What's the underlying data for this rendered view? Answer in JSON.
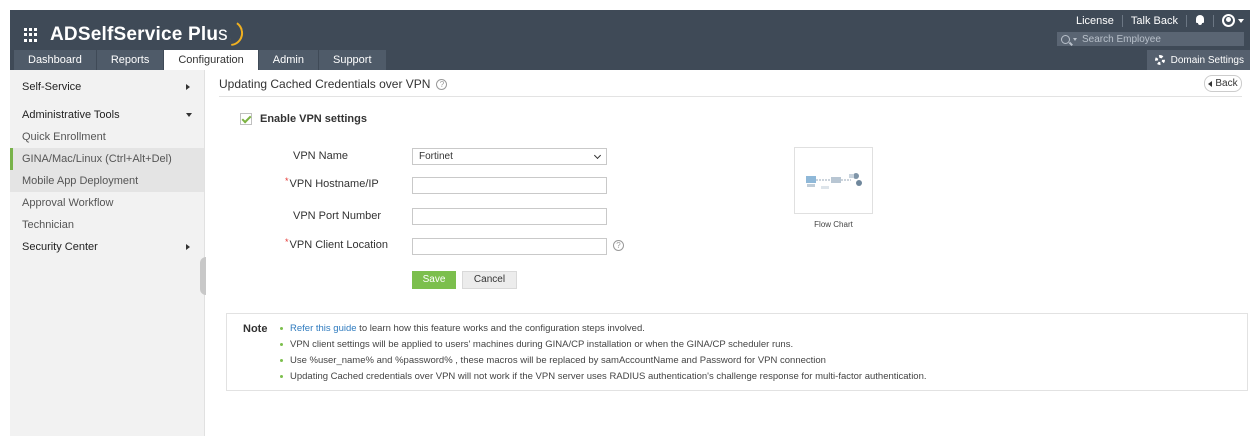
{
  "app": {
    "brand_main": "ADSelfService Plu",
    "brand_plus": "s"
  },
  "topbar": {
    "license": "License",
    "talk_back": "Talk Back",
    "search_placeholder": "Search Employee",
    "domain_settings": "Domain Settings"
  },
  "tabs": [
    {
      "label": "Dashboard"
    },
    {
      "label": "Reports"
    },
    {
      "label": "Configuration"
    },
    {
      "label": "Admin"
    },
    {
      "label": "Support"
    }
  ],
  "sidebar": {
    "items": [
      {
        "label": "Self-Service"
      },
      {
        "label": "Administrative Tools"
      },
      {
        "label": "Quick Enrollment"
      },
      {
        "label": "GINA/Mac/Linux (Ctrl+Alt+Del)"
      },
      {
        "label": "Mobile App Deployment"
      },
      {
        "label": "Approval Workflow"
      },
      {
        "label": "Technician"
      },
      {
        "label": "Security Center"
      }
    ]
  },
  "page": {
    "title": "Updating Cached Credentials over VPN",
    "back_label": "Back",
    "enable_label": "Enable VPN settings"
  },
  "form": {
    "vpn_name_label": "VPN Name",
    "vpn_name_value": "Fortinet",
    "hostname_label": "VPN Hostname/IP",
    "port_label": "VPN Port Number",
    "client_location_label": "VPN Client Location",
    "required_mark": "*",
    "save": "Save",
    "cancel": "Cancel",
    "flow_chart_caption": "Flow Chart"
  },
  "note": {
    "title": "Note",
    "link_text": "Refer this guide",
    "line1_rest": " to learn how this feature works and the configuration steps involved.",
    "line2": "VPN client settings will be applied to users' machines during GINA/CP installation or when the GINA/CP scheduler runs.",
    "line3": "Use %user_name% and %password% , these macros will be replaced by samAccountName and Password for VPN connection",
    "line4": "Updating Cached credentials over VPN will not work if the VPN server uses RADIUS authentication's challenge response for multi-factor authentication."
  }
}
